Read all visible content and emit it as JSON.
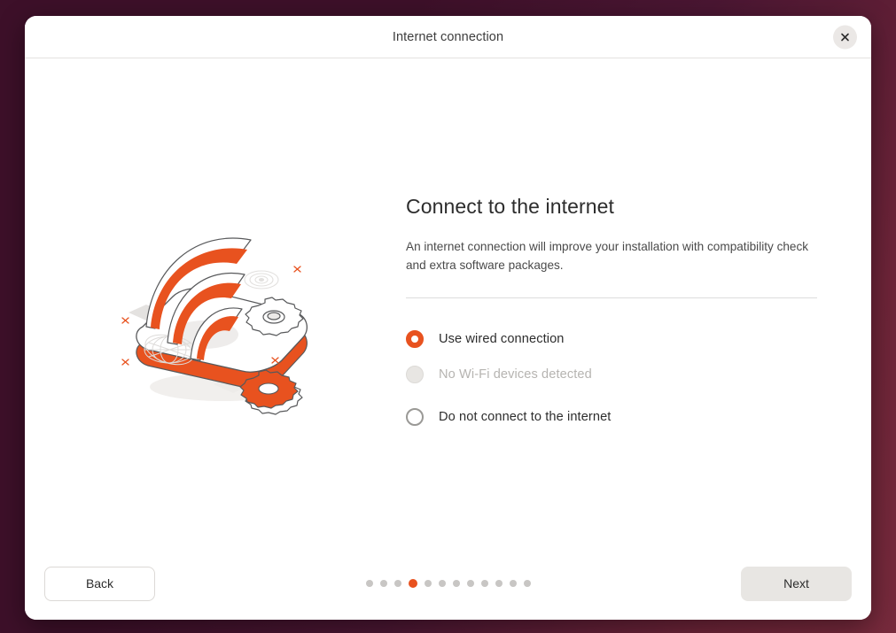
{
  "window": {
    "title": "Internet connection",
    "close_icon": "close-icon"
  },
  "main": {
    "heading": "Connect to the internet",
    "description": "An internet connection will improve your installation with compatibility check and extra software packages.",
    "illustration_name": "cloud-wifi-illustration",
    "options": [
      {
        "label": "Use wired connection",
        "state": "selected",
        "disabled": false
      },
      {
        "label": "No Wi-Fi devices detected",
        "state": "unselected",
        "disabled": true
      },
      {
        "label": "Do not connect to the internet",
        "state": "unselected",
        "disabled": false
      }
    ]
  },
  "footer": {
    "back_label": "Back",
    "next_label": "Next",
    "pager": {
      "total": 12,
      "current": 4
    }
  },
  "colors": {
    "accent": "#e8521f",
    "desktop": "#3d1029",
    "window": "#ffffff",
    "muted_text": "#b6b4b1",
    "button_fill": "#e8e6e3"
  }
}
